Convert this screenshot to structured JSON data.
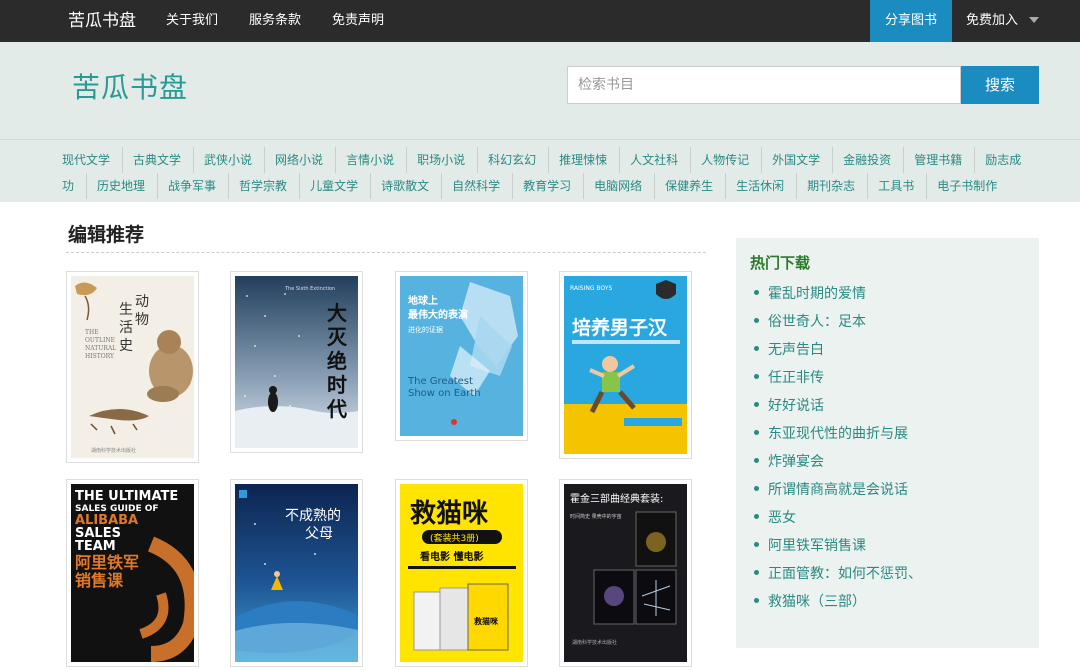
{
  "topbar": {
    "brand": "苦瓜书盘",
    "nav": [
      "关于我们",
      "服务条款",
      "免责声明"
    ],
    "share": "分享图书",
    "join": "免费加入"
  },
  "header": {
    "logo": "苦瓜书盘",
    "search_placeholder": "检索书目",
    "search_button": "搜索"
  },
  "categories": {
    "row1": [
      "现代文学",
      "古典文学",
      "武侠小说",
      "网络小说",
      "言情小说",
      "职场小说",
      "科幻玄幻",
      "推理悚悚",
      "人文社科",
      "人物传记",
      "外国文学",
      "金融投资",
      "管理书籍",
      "励志成"
    ],
    "row2": [
      "功",
      "历史地理",
      "战争军事",
      "哲学宗教",
      "儿童文学",
      "诗歌散文",
      "自然科学",
      "教育学习",
      "电脑网络",
      "保健养生",
      "生活休闲",
      "期刊杂志",
      "工具书",
      "电子书制作"
    ]
  },
  "main": {
    "title": "编辑推荐"
  },
  "covers": {
    "c1": {
      "title": "动物生活史",
      "en": "THE OUTLINE OF NATURAL HISTORY"
    },
    "c2": {
      "title": "大灭绝时代"
    },
    "c3": {
      "title": "地球上最伟大的表演",
      "sub": "进化的证据",
      "en": "The Greatest Show on Earth"
    },
    "c4": {
      "title": "培养男子汉",
      "en": "RAISING BOYS"
    },
    "c5": {
      "en1": "THE ULTIMATE",
      "en2": "SALES GUIDE OF",
      "en3": "ALIBABA",
      "en4": "SALES",
      "en5": "TEAM",
      "title": "阿里铁军销售课"
    },
    "c6": {
      "title": "不成熟的父母"
    },
    "c7": {
      "title": "救猫咪",
      "sub": "(套装共3册)",
      "tag": "看电影 懂电影"
    },
    "c8": {
      "title": "霍金三部曲经典套装:"
    }
  },
  "sidebar": {
    "title": "热门下载",
    "items": [
      "霍乱时期的爱情",
      "俗世奇人：足本",
      "无声告白",
      "任正非传",
      "好好说话",
      "东亚现代性的曲折与展",
      "炸弹宴会",
      "所谓情商高就是会说话",
      "恶女",
      "阿里铁军销售课",
      "正面管教：如何不惩罚、",
      "救猫咪（三部）"
    ]
  },
  "colors": {
    "accent": "#1a8cbf",
    "teal": "#2a9b94",
    "topbar": "#2b2b2b",
    "band": "#e3ebe8",
    "hot_title": "#2c7a2c"
  }
}
